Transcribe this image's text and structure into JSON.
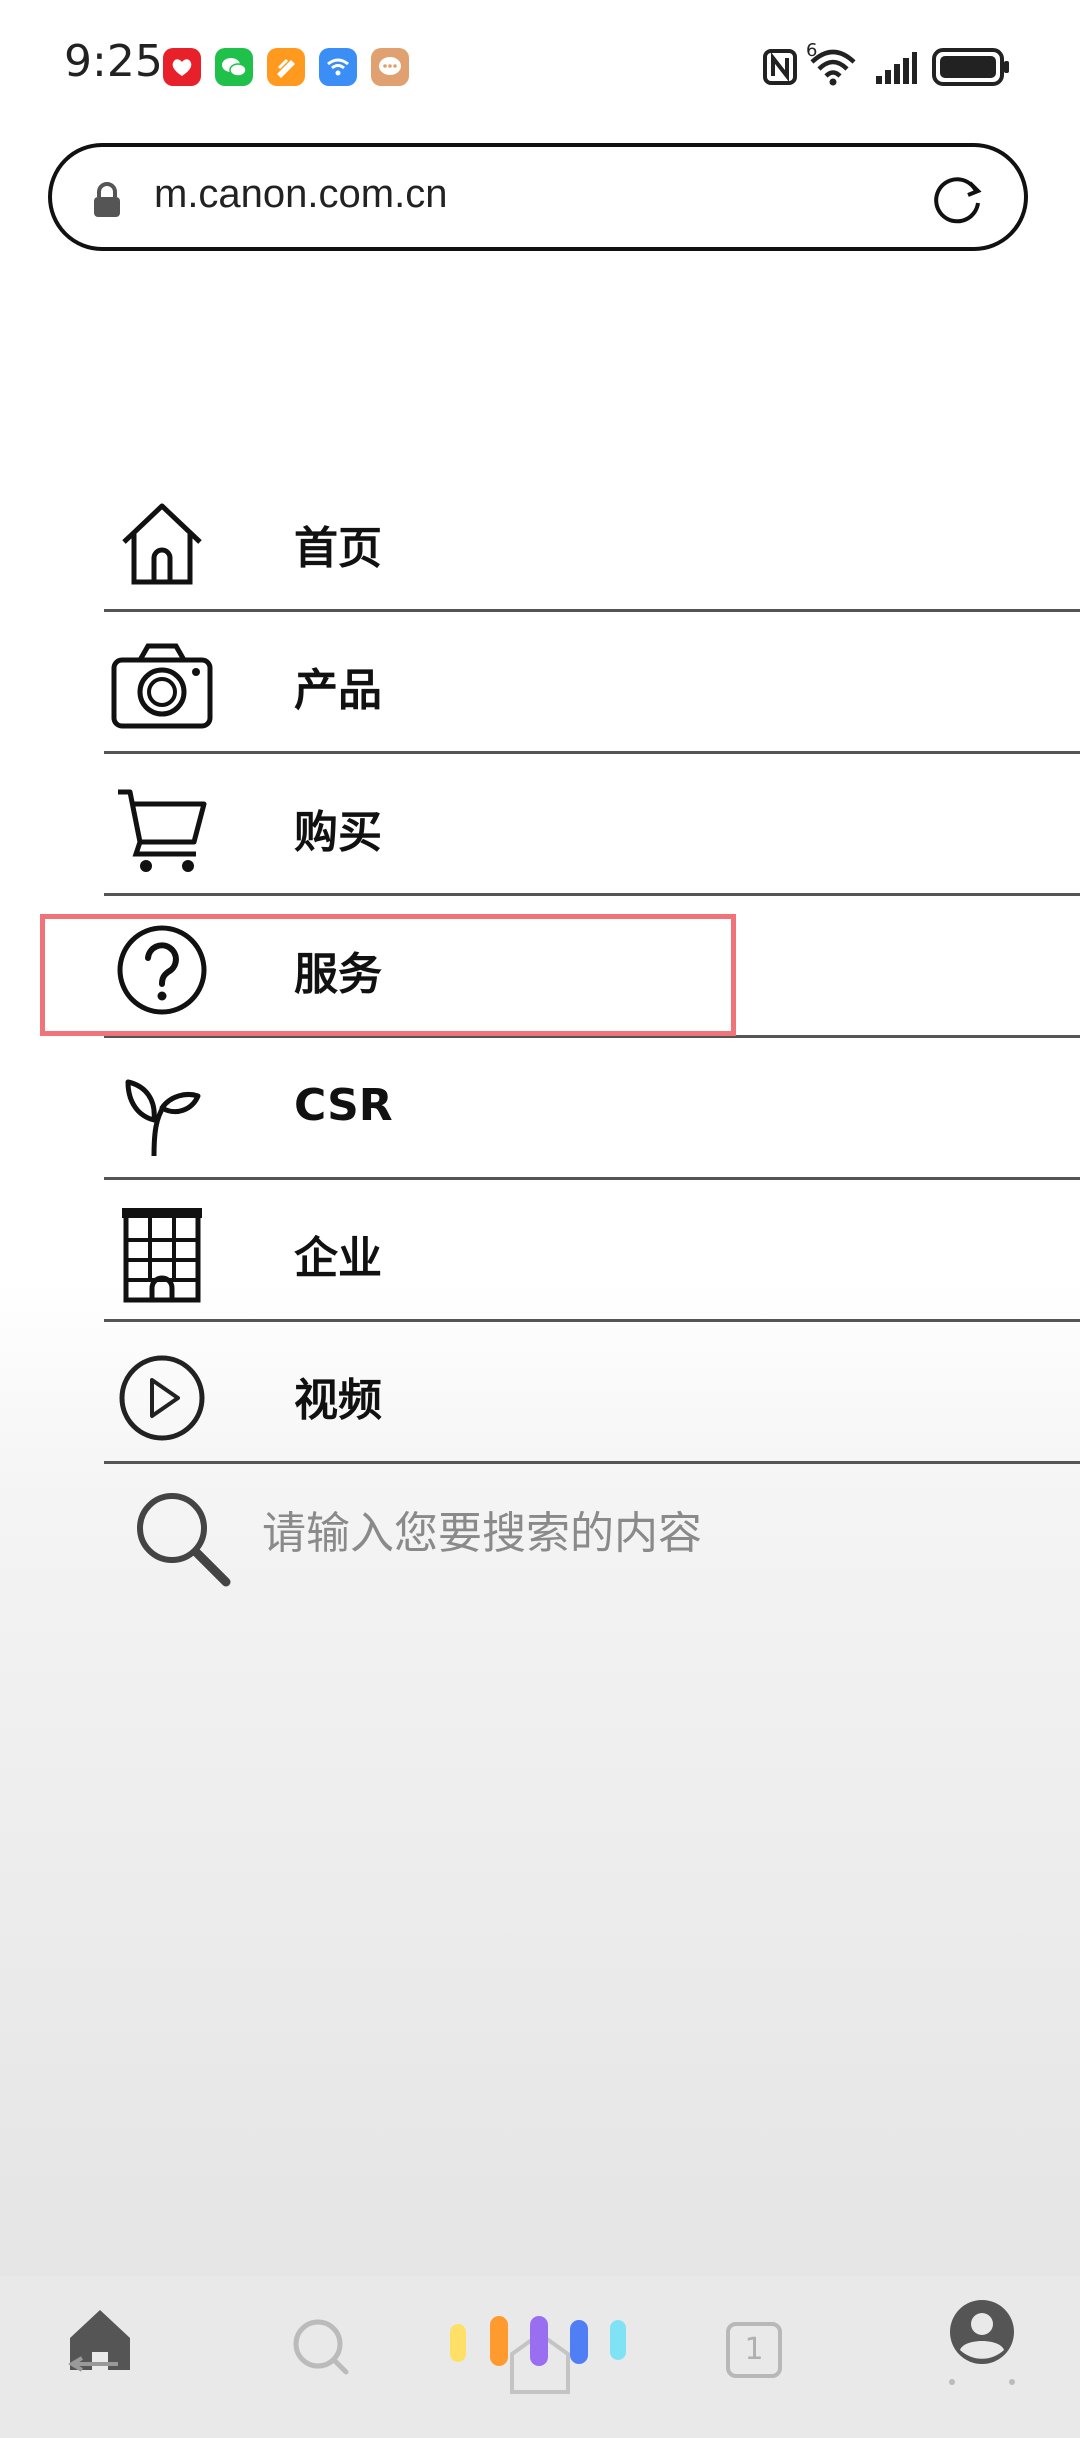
{
  "status_bar": {
    "time": "9:25",
    "signal_badge": "6",
    "apps": [
      {
        "name": "gift-app-icon",
        "color": "#e8202a"
      },
      {
        "name": "wechat-icon",
        "color": "#1fc14a"
      },
      {
        "name": "pen-app-icon",
        "color": "#ff9a1f"
      },
      {
        "name": "wifi-app-icon",
        "color": "#3a8ef5"
      },
      {
        "name": "chat-bubble-app-icon",
        "color": "#e0a070"
      }
    ]
  },
  "url_bar": {
    "url": "m.canon.com.cn"
  },
  "menu": {
    "items": [
      {
        "label": "首页",
        "icon": "home-icon"
      },
      {
        "label": "产品",
        "icon": "camera-icon"
      },
      {
        "label": "购买",
        "icon": "shopping-cart-icon"
      },
      {
        "label": "服务",
        "icon": "question-circle-icon"
      },
      {
        "label": "CSR",
        "icon": "sprout-icon"
      },
      {
        "label": "企业",
        "icon": "building-icon"
      },
      {
        "label": "视频",
        "icon": "play-circle-icon"
      }
    ],
    "highlight_color": "#f0737a"
  },
  "search": {
    "placeholder": "请输入您要搜索的内容"
  },
  "bottom_nav": {
    "tab_count": "1",
    "assistant_colors": [
      "#ffe066",
      "#ff9a2e",
      "#9a6ef0",
      "#4f7ef5",
      "#7fe3f5"
    ]
  }
}
